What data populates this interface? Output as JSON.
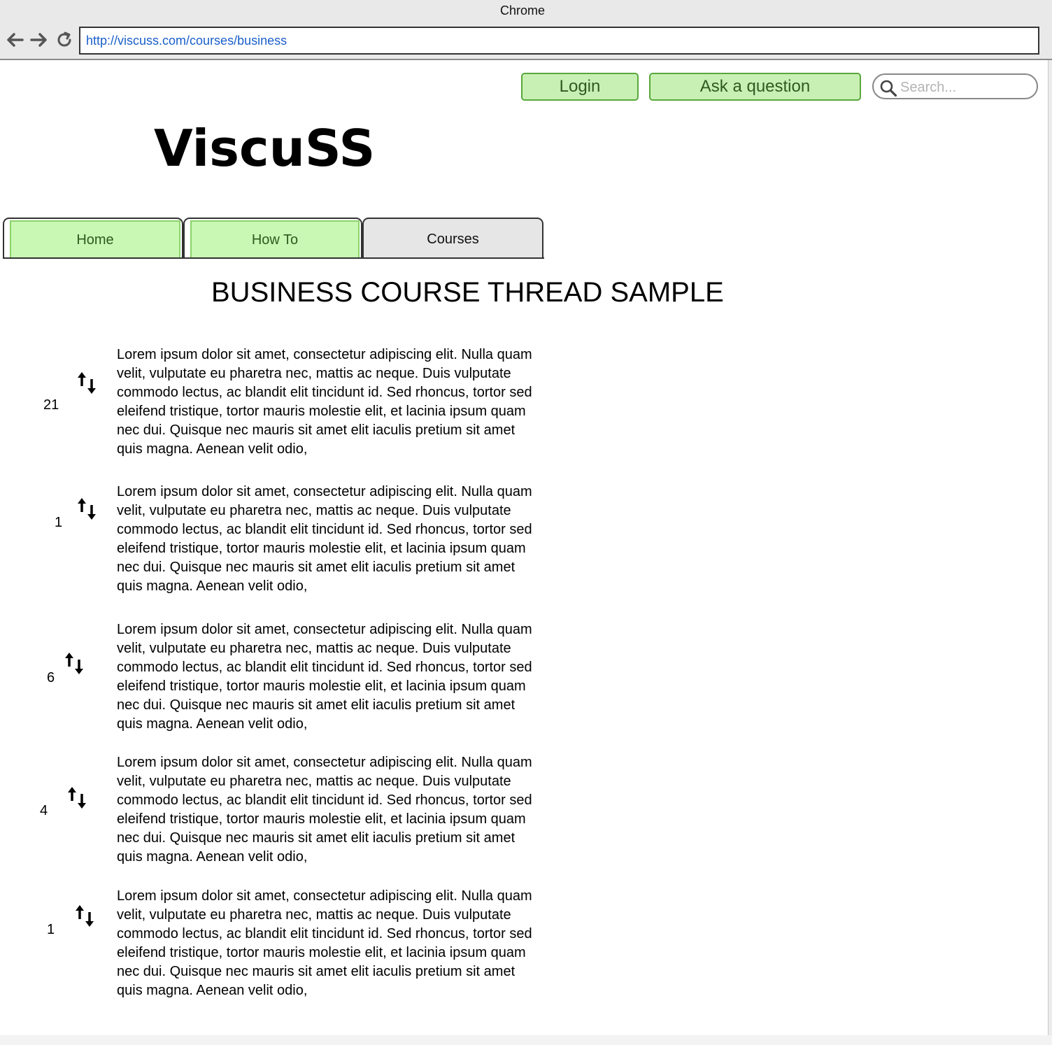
{
  "browser": {
    "window_title": "Chrome",
    "url": "http://viscuss.com/courses/business",
    "back_icon": "arrow-left-icon",
    "forward_icon": "arrow-right-icon",
    "reload_icon": "reload-icon"
  },
  "header": {
    "login_label": "Login",
    "ask_label": "Ask a question",
    "search_placeholder": "Search...",
    "search_icon": "search-icon",
    "logo_text": "ViscuSS"
  },
  "tabs": [
    {
      "label": "Home",
      "active": false
    },
    {
      "label": "How To",
      "active": false
    },
    {
      "label": "Courses",
      "active": true
    }
  ],
  "page": {
    "title": "BUSINESS COURSE THREAD SAMPLE"
  },
  "posts": [
    {
      "votes": "21",
      "text": "Lorem ipsum dolor sit amet, consectetur adipiscing elit. Nulla quam velit, vulputate eu pharetra nec, mattis ac neque. Duis vulputate commodo lectus, ac blandit elit tincidunt id. Sed rhoncus, tortor sed eleifend tristique, tortor mauris molestie elit, et lacinia ipsum quam nec dui. Quisque nec mauris sit amet elit iaculis pretium sit amet quis magna. Aenean velit odio,"
    },
    {
      "votes": "1",
      "text": "Lorem ipsum dolor sit amet, consectetur adipiscing elit. Nulla quam velit, vulputate eu pharetra nec, mattis ac neque. Duis vulputate commodo lectus, ac blandit elit tincidunt id. Sed rhoncus, tortor sed eleifend tristique, tortor mauris molestie elit, et lacinia ipsum quam nec dui. Quisque nec mauris sit amet elit iaculis pretium sit amet quis magna. Aenean velit odio,"
    },
    {
      "votes": "6",
      "text": "Lorem ipsum dolor sit amet, consectetur adipiscing elit. Nulla quam velit, vulputate eu pharetra nec, mattis ac neque. Duis vulputate commodo lectus, ac blandit elit tincidunt id. Sed rhoncus, tortor sed eleifend tristique, tortor mauris molestie elit, et lacinia ipsum quam nec dui. Quisque nec mauris sit amet elit iaculis pretium sit amet quis magna. Aenean velit odio,"
    },
    {
      "votes": "4",
      "text": "Lorem ipsum dolor sit amet, consectetur adipiscing elit. Nulla quam velit, vulputate eu pharetra nec, mattis ac neque. Duis vulputate commodo lectus, ac blandit elit tincidunt id. Sed rhoncus, tortor sed eleifend tristique, tortor mauris molestie elit, et lacinia ipsum quam nec dui. Quisque nec mauris sit amet elit iaculis pretium sit amet quis magna. Aenean velit odio,"
    },
    {
      "votes": "1",
      "text": "Lorem ipsum dolor sit amet, consectetur adipiscing elit. Nulla quam velit, vulputate eu pharetra nec, mattis ac neque. Duis vulputate commodo lectus, ac blandit elit tincidunt id. Sed rhoncus, tortor sed eleifend tristique, tortor mauris molestie elit, et lacinia ipsum quam nec dui. Quisque nec mauris sit amet elit iaculis pretium sit amet quis magna. Aenean velit odio,"
    }
  ],
  "vote_icon": "sort-arrows-icon",
  "colors": {
    "button_fill": "#c8f0b4",
    "button_border": "#59a83b",
    "button_text": "#2f5a1f",
    "url_text": "#1a5fc9",
    "active_tab_fill": "#e6e6e6"
  }
}
